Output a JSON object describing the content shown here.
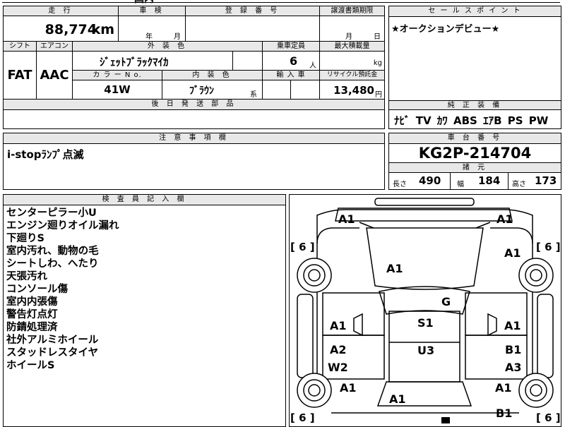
{
  "sheet": {
    "top_cutoff_text": "国内",
    "mileage": {
      "label": "走 行",
      "value": "88,774",
      "unit": "km"
    },
    "shaken": {
      "label": "車 検",
      "year": "年",
      "month": "月"
    },
    "registration": {
      "label": "登 録 番 号",
      "value": ""
    },
    "transfer": {
      "label": "譲渡書類期限",
      "month": "月",
      "day": "日"
    },
    "shift": {
      "label": "シフト",
      "value": "FAT"
    },
    "aircon": {
      "label": "エアコン",
      "value": "AAC"
    },
    "exterior": {
      "label": "外 装 色",
      "value": "ｼﾞｪｯﾄﾌﾞﾗｯｸﾏｲｶ"
    },
    "capacity": {
      "label": "乗車定員",
      "value": "6",
      "unit": "人"
    },
    "max_load": {
      "label": "最大積載量",
      "unit": "kg"
    },
    "color_no": {
      "label": "カ ラ ー N o.",
      "value": "41W"
    },
    "interior": {
      "label": "内 装 色",
      "value": "ﾌﾞﾗｳﾝ",
      "suffix": "系"
    },
    "import": {
      "label": "輸 入 車"
    },
    "recycle": {
      "label": "リサイクル預託金",
      "value": "13,480",
      "unit": "円"
    },
    "shipping": {
      "label": "後 日 発 送 部 品"
    },
    "sales_point": {
      "label": "セ ー ル ス ポ イ ン ト",
      "text": "★オークションデビュー★"
    },
    "equipment": {
      "label": "純 正 装 備",
      "text": "ﾅﾋﾞ TV ｶﾜ ABS ｴｱB PS PW"
    },
    "notes": {
      "label": "注 意 事 項 欄",
      "text": "i-stopﾗﾝﾌﾟ点滅"
    },
    "chassis": {
      "label": "車 台 番 号",
      "value": "KG2P-214704"
    },
    "specs": {
      "label": "諸 元",
      "length_label": "長さ",
      "length": "490",
      "width_label": "幅",
      "width": "184",
      "height_label": "高さ",
      "height": "173"
    },
    "inspector": {
      "label": "検 査 員 記 入 欄",
      "lines": [
        "センターピラー小U",
        "エンジン廻りオイル漏れ",
        "下廻りS",
        "室内汚れ、動物の毛",
        "シートしわ、へたり",
        "天張汚れ",
        "コンソール傷",
        "室内内張傷",
        "警告灯点灯",
        "防錆処理済",
        "社外アルミホイール",
        "スタッドレスタイヤ",
        "ホイールS"
      ]
    },
    "diagram": {
      "marks": {
        "front_left": "A1",
        "front_right": "A1",
        "fl_fender": "A1",
        "fr_fender": "A1",
        "hood": "A1",
        "windshield": "G",
        "roof": "S1",
        "roof_rear": "U3",
        "front_door_left": "A1",
        "front_door_right": "A1",
        "rear_door_left_1": "A2",
        "rear_door_left_2": "W2",
        "rear_door_right_1": "B1",
        "rear_door_right_2": "A3",
        "rear_fender_left": "A1",
        "rear_fender_right": "A1",
        "rear_gate": "A1",
        "rear_bumper_right": "B1"
      },
      "tires": {
        "fl": "[ 6 ]",
        "fr": "[ 6 ]",
        "rl": "[ 6 ]",
        "rr": "[ 6 ]"
      }
    }
  }
}
